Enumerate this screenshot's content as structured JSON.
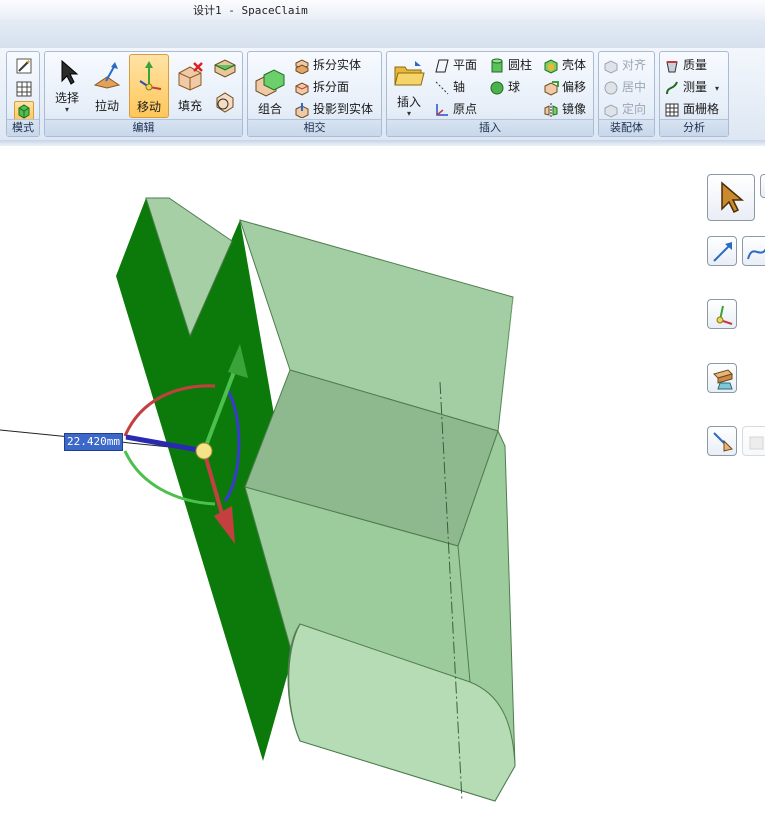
{
  "window": {
    "title": "设计1 - SpaceClaim"
  },
  "ribbon": {
    "mode_group": {
      "label": "模式"
    },
    "edit_group": {
      "label": "编辑",
      "select": "选择",
      "pull": "拉动",
      "move": "移动",
      "fill": "填充"
    },
    "intersect_group": {
      "label": "相交",
      "combine": "组合",
      "split_body": "拆分实体",
      "split_face": "拆分面",
      "project_to_body": "投影到实体"
    },
    "insert_group": {
      "label": "插入",
      "insert": "插入",
      "plane": "平面",
      "axis": "轴",
      "origin": "原点",
      "cylinder": "圆柱",
      "sphere": "球",
      "shell": "壳体",
      "offset": "偏移",
      "mirror": "镜像"
    },
    "assembly_group": {
      "label": "装配体",
      "align": "对齐",
      "center": "居中",
      "orient": "定向"
    },
    "analysis_group": {
      "label": "分析",
      "mass": "质量",
      "measure": "测量",
      "mesh": "面栅格"
    }
  },
  "viewport": {
    "dimension_value": "22.420mm",
    "colors": {
      "face_dark": "#0b7a0b",
      "face_light": "#a6cfa6",
      "face_mid": "#93c293",
      "edge": "#4f7d4f"
    }
  }
}
